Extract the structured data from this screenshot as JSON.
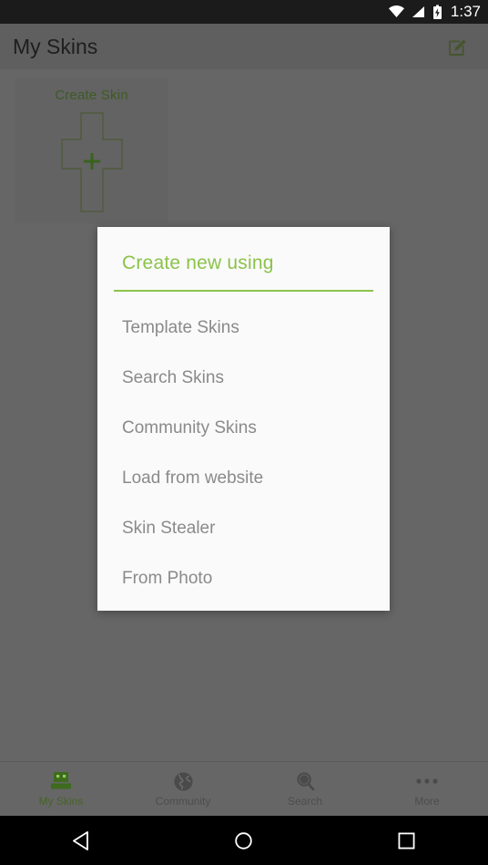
{
  "status_bar": {
    "time": "1:37",
    "icons": [
      "wifi-icon",
      "cellular-signal-icon",
      "battery-charging-icon"
    ]
  },
  "app_bar": {
    "title": "My Skins",
    "action_icon": "edit-icon"
  },
  "content": {
    "skin_card": {
      "label": "Create Skin",
      "net_icon": "skin-net-plus-icon"
    }
  },
  "dialog": {
    "title": "Create new using",
    "accent_color": "#8bc34a",
    "items": [
      {
        "label": "Template Skins"
      },
      {
        "label": "Search Skins"
      },
      {
        "label": "Community Skins"
      },
      {
        "label": "Load from website"
      },
      {
        "label": "Skin Stealer"
      },
      {
        "label": "From Photo"
      }
    ]
  },
  "tab_bar": {
    "active_color": "#47632a",
    "inactive_color": "#4d4d4d",
    "tabs": [
      {
        "label": "My Skins",
        "icon": "minecraft-head-icon",
        "active": true
      },
      {
        "label": "Community",
        "icon": "globe-icon",
        "active": false
      },
      {
        "label": "Search",
        "icon": "magnifier-icon",
        "active": false
      },
      {
        "label": "More",
        "icon": "overflow-dots-icon",
        "active": false
      }
    ]
  },
  "android_nav": {
    "back": "back-triangle-icon",
    "home": "home-circle-icon",
    "recents": "recents-square-icon"
  }
}
